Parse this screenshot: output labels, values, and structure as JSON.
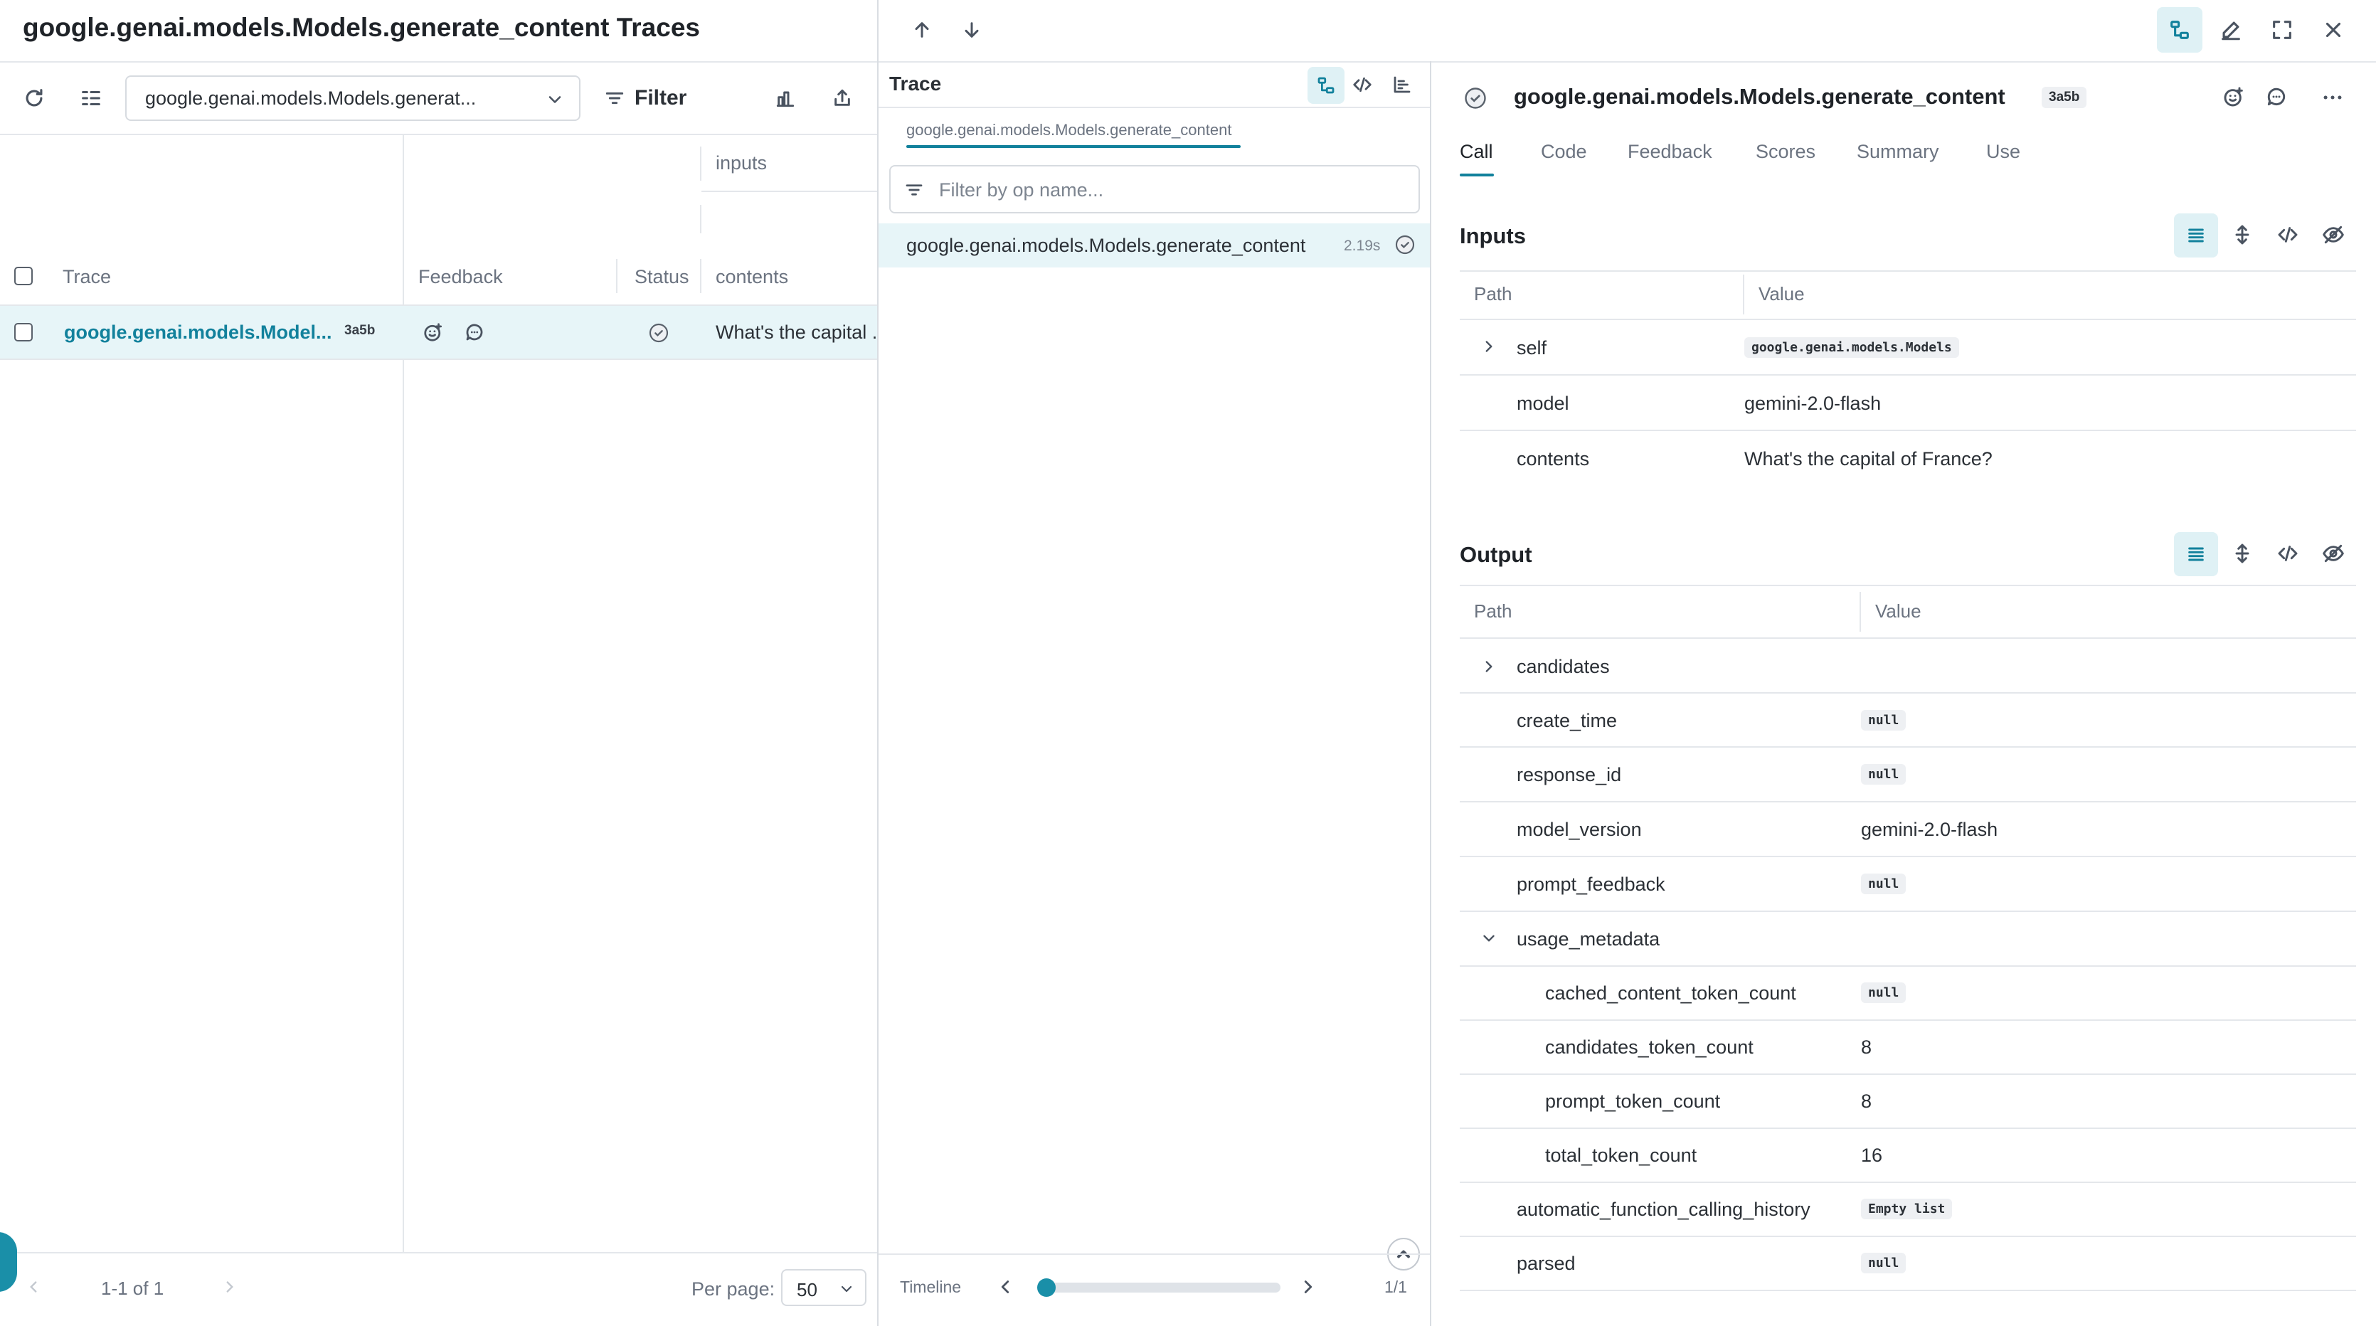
{
  "app": {
    "title": "google.genai.models.Models.generate_content Traces"
  },
  "left": {
    "op_select_value": "google.genai.models.Models.generat...",
    "filter_label": "Filter",
    "col_group_inputs": "inputs",
    "columns": {
      "trace": "Trace",
      "feedback": "Feedback",
      "status": "Status",
      "contents": "contents"
    },
    "row": {
      "name": "google.genai.models.Model...",
      "id": "3a5b",
      "contents": "What's the capital ..."
    },
    "pagination": {
      "range": "1-1 of 1",
      "per_page_label": "Per page:",
      "per_page_value": "50"
    }
  },
  "trace": {
    "title": "Trace",
    "breadcrumb": "google.genai.models.Models.generate_content",
    "filter_placeholder": "Filter by op name...",
    "node": {
      "name": "google.genai.models.Models.generate_content",
      "duration": "2.19s"
    },
    "timeline_label": "Timeline",
    "timeline_count": "1/1",
    "timeline_progress": 0
  },
  "detail": {
    "title": "google.genai.models.Models.generate_content",
    "id": "3a5b",
    "tabs": [
      "Call",
      "Code",
      "Feedback",
      "Scores",
      "Summary",
      "Use"
    ],
    "active_tab": "Call",
    "inputs": {
      "heading": "Inputs",
      "col_path": "Path",
      "col_value": "Value",
      "rows": [
        {
          "path": "self",
          "value": "google.genai.models.Models"
        },
        {
          "path": "model",
          "value": "gemini-2.0-flash"
        },
        {
          "path": "contents",
          "value": "What's the capital of France?"
        }
      ]
    },
    "output": {
      "heading": "Output",
      "col_path": "Path",
      "col_value": "Value",
      "rows": [
        {
          "path": "candidates",
          "value": ""
        },
        {
          "path": "create_time",
          "value": "null"
        },
        {
          "path": "response_id",
          "value": "null"
        },
        {
          "path": "model_version",
          "value": "gemini-2.0-flash"
        },
        {
          "path": "prompt_feedback",
          "value": "null"
        },
        {
          "path": "usage_metadata",
          "value": ""
        },
        {
          "path": "cached_content_token_count",
          "value": "null"
        },
        {
          "path": "candidates_token_count",
          "value": "8"
        },
        {
          "path": "prompt_token_count",
          "value": "8"
        },
        {
          "path": "total_token_count",
          "value": "16"
        },
        {
          "path": "automatic_function_calling_history",
          "value": "Empty list"
        },
        {
          "path": "parsed",
          "value": "null"
        }
      ]
    }
  },
  "colors": {
    "accent": "#12819c",
    "row_highlight": "#e7f5f8",
    "border": "#e4e7eb"
  }
}
